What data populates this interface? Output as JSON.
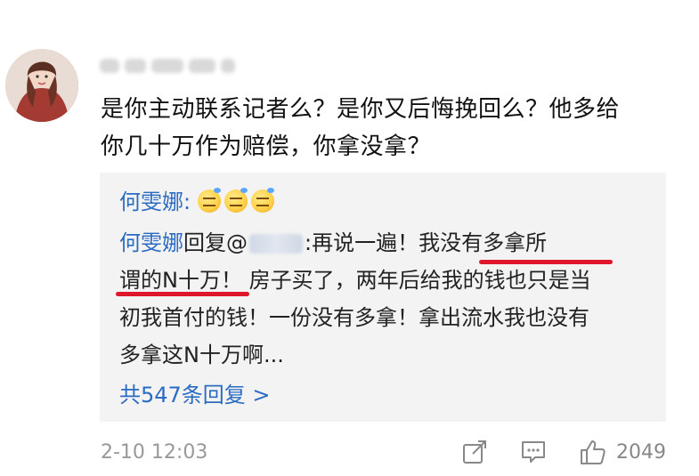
{
  "comment": {
    "text": "是你主动联系记者么？是你又后悔挽回么？他多给你几十万作为赔偿，你拿没拿？",
    "line1": "是你主动联系记者么？是你又后悔挽回么？他多给",
    "line2": "你几十万作为赔偿，你拿没拿？",
    "time": "2-10 12:03",
    "like_count": "2049"
  },
  "replies": {
    "reply1": {
      "author": "何雯娜:"
    },
    "reply2": {
      "author": "何雯娜",
      "prefix": "回复@",
      "after_name": ":再说一遍！",
      "emph1": "我没有多拿所",
      "emph2": "谓的N十万！",
      "line2_rest": " 房子买了，两年后给我的钱也只是当",
      "line3": "初我首付的钱！一份没有多拿！拿出流水我也没有",
      "line4": "多拿这N十万啊..."
    },
    "more_label": "共547条回复 >"
  },
  "icons": [
    "avatar",
    "emoji-icon",
    "share-icon",
    "comment-icon",
    "like-icon"
  ],
  "colors": {
    "link": "#2a6cc3",
    "underline": "#e0162b",
    "reply_bg": "#f3f3f3",
    "meta": "#999999"
  }
}
